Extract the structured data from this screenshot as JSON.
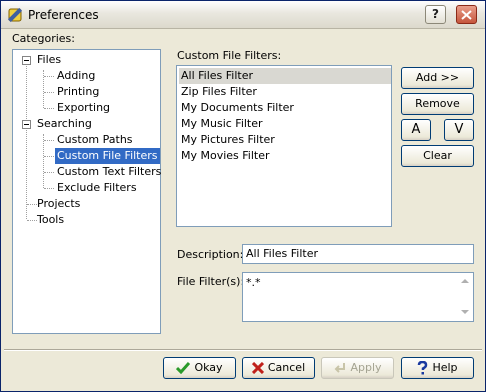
{
  "window": {
    "title": "Preferences",
    "help_glyph": "?"
  },
  "categories": {
    "label": "Categories:",
    "tree": [
      {
        "label": "Files",
        "level": 0,
        "expanded": true
      },
      {
        "label": "Adding",
        "level": 1
      },
      {
        "label": "Printing",
        "level": 1
      },
      {
        "label": "Exporting",
        "level": 1
      },
      {
        "label": "Searching",
        "level": 0,
        "expanded": true
      },
      {
        "label": "Custom Paths",
        "level": 1
      },
      {
        "label": "Custom File Filters",
        "level": 1,
        "selected": true
      },
      {
        "label": "Custom Text Filters",
        "level": 1
      },
      {
        "label": "Exclude Filters",
        "level": 1
      },
      {
        "label": "Projects",
        "level": 0
      },
      {
        "label": "Tools",
        "level": 0
      }
    ]
  },
  "filters": {
    "label": "Custom File Filters:",
    "items": [
      "All Files Filter",
      "Zip Files Filter",
      "My Documents Filter",
      "My Music Filter",
      "My Pictures Filter",
      "My Movies Filter"
    ],
    "selected_index": 0
  },
  "side_buttons": {
    "add": "Add >>",
    "remove": "Remove",
    "up_glyph": "A",
    "down_glyph": "V",
    "clear": "Clear"
  },
  "description": {
    "label": "Description:",
    "value": "All Files Filter"
  },
  "file_filters": {
    "label": "File Filter(s):",
    "value": "*.*"
  },
  "footer": {
    "okay": "Okay",
    "cancel": "Cancel",
    "apply": "Apply",
    "help": "Help"
  },
  "colors": {
    "selection": "#316ac5",
    "highlight": "#d9d8d2",
    "face": "#ece9d8"
  }
}
